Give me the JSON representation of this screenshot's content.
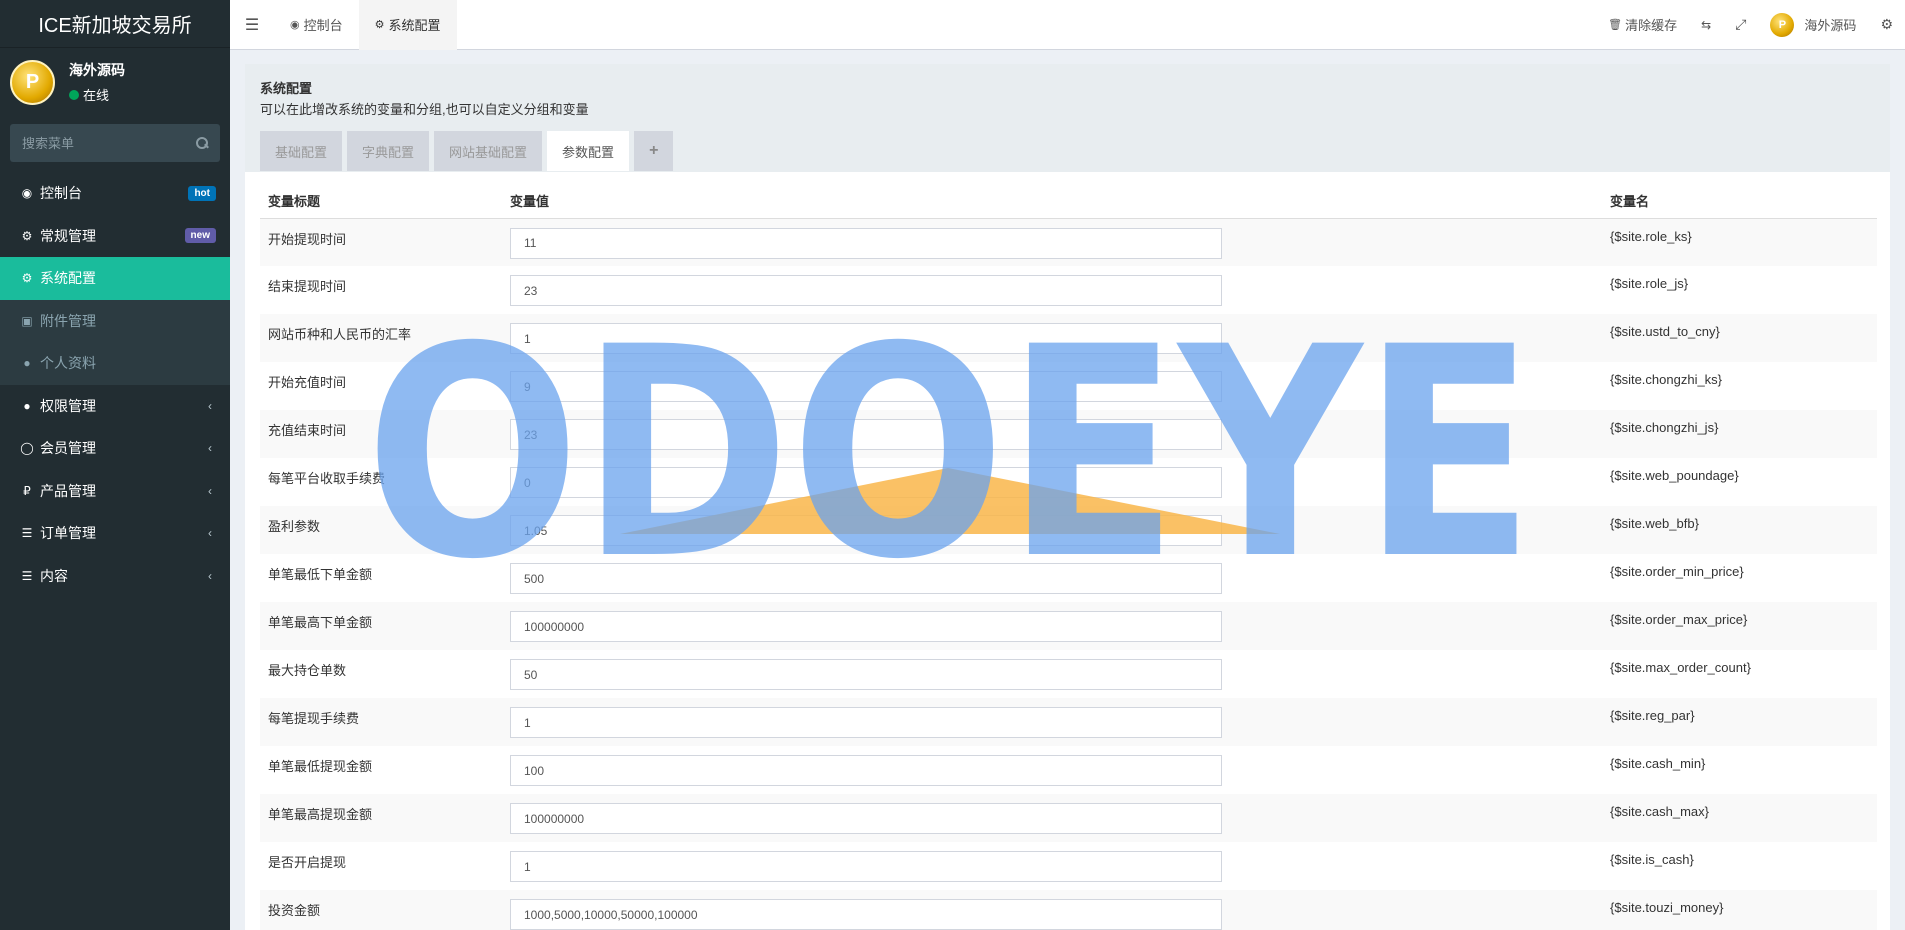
{
  "sidebar": {
    "app_title": "ICE新加坡交易所",
    "user": {
      "name": "海外源码",
      "status": "在线",
      "avatar_letter": "P"
    },
    "search_placeholder": "搜索菜单",
    "menu": [
      {
        "label": "控制台",
        "icon": "dashboard-icon",
        "glyph": "◉",
        "badge": "hot",
        "state": "normal"
      },
      {
        "label": "常规管理",
        "icon": "cogs-icon",
        "glyph": "⚙",
        "badge": "new",
        "state": "normal"
      },
      {
        "label": "系统配置",
        "icon": "gear-icon",
        "glyph": "⚙",
        "state": "active"
      },
      {
        "label": "附件管理",
        "icon": "file-image-icon",
        "glyph": "▣",
        "state": "sub"
      },
      {
        "label": "个人资料",
        "icon": "user-icon",
        "glyph": "●",
        "state": "sub"
      },
      {
        "label": "权限管理",
        "icon": "group-icon",
        "glyph": "●",
        "state": "normal",
        "chevron": true
      },
      {
        "label": "会员管理",
        "icon": "user-circle-icon",
        "glyph": "◯",
        "state": "normal",
        "chevron": true
      },
      {
        "label": "产品管理",
        "icon": "ruble-icon",
        "glyph": "₽",
        "state": "normal",
        "chevron": true
      },
      {
        "label": "订单管理",
        "icon": "list-icon",
        "glyph": "☰",
        "state": "normal",
        "chevron": true
      },
      {
        "label": "内容",
        "icon": "list-icon",
        "glyph": "☰",
        "state": "normal",
        "chevron": true
      }
    ]
  },
  "topbar": {
    "tabs": [
      {
        "label": "控制台",
        "icon": "dashboard-icon",
        "glyph": "◉",
        "active": false
      },
      {
        "label": "系统配置",
        "icon": "gear-icon",
        "glyph": "⚙",
        "active": true
      }
    ],
    "clear_cache": "清除缓存",
    "user_name": "海外源码"
  },
  "panel": {
    "title": "系统配置",
    "description": "可以在此增改系统的变量和分组,也可以自定义分组和变量",
    "tabs": [
      "基础配置",
      "字典配置",
      "网站基础配置",
      "参数配置"
    ],
    "active_tab": 3,
    "add_tab": "+"
  },
  "table": {
    "headers": {
      "title": "变量标题",
      "value": "变量值",
      "name": "变量名"
    },
    "rows": [
      {
        "title": "开始提现时间",
        "value": "11",
        "name": "{$site.role_ks}"
      },
      {
        "title": "结束提现时间",
        "value": "23",
        "name": "{$site.role_js}"
      },
      {
        "title": "网站币种和人民币的汇率",
        "value": "1",
        "name": "{$site.ustd_to_cny}"
      },
      {
        "title": "开始充值时间",
        "value": "9",
        "name": "{$site.chongzhi_ks}"
      },
      {
        "title": "充值结束时间",
        "value": "23",
        "name": "{$site.chongzhi_js}"
      },
      {
        "title": "每笔平台收取手续费",
        "value": "0",
        "name": "{$site.web_poundage}"
      },
      {
        "title": "盈利参数",
        "value": "1.05",
        "name": "{$site.web_bfb}"
      },
      {
        "title": "单笔最低下单金额",
        "value": "500",
        "name": "{$site.order_min_price}"
      },
      {
        "title": "单笔最高下单金额",
        "value": "100000000",
        "name": "{$site.order_max_price}"
      },
      {
        "title": "最大持仓单数",
        "value": "50",
        "name": "{$site.max_order_count}"
      },
      {
        "title": "每笔提现手续费",
        "value": "1",
        "name": "{$site.reg_par}"
      },
      {
        "title": "单笔最低提现金额",
        "value": "100",
        "name": "{$site.cash_min}"
      },
      {
        "title": "单笔最高提现金额",
        "value": "100000000",
        "name": "{$site.cash_max}"
      },
      {
        "title": "是否开启提现",
        "value": "1",
        "name": "{$site.is_cash}"
      },
      {
        "title": "投资金额",
        "value": "1000,5000,10000,50000,100000",
        "name": "{$site.touzi_money}"
      }
    ]
  },
  "watermark": {
    "text": "ODOEYE",
    "color_blue": "#6aa3ee",
    "color_orange": "#f9b64a"
  },
  "colors": {
    "sidebar_bg": "#222d32",
    "active_menu": "#1abc9c",
    "badge_hot": "#0073b7",
    "badge_new": "#605ca8"
  }
}
